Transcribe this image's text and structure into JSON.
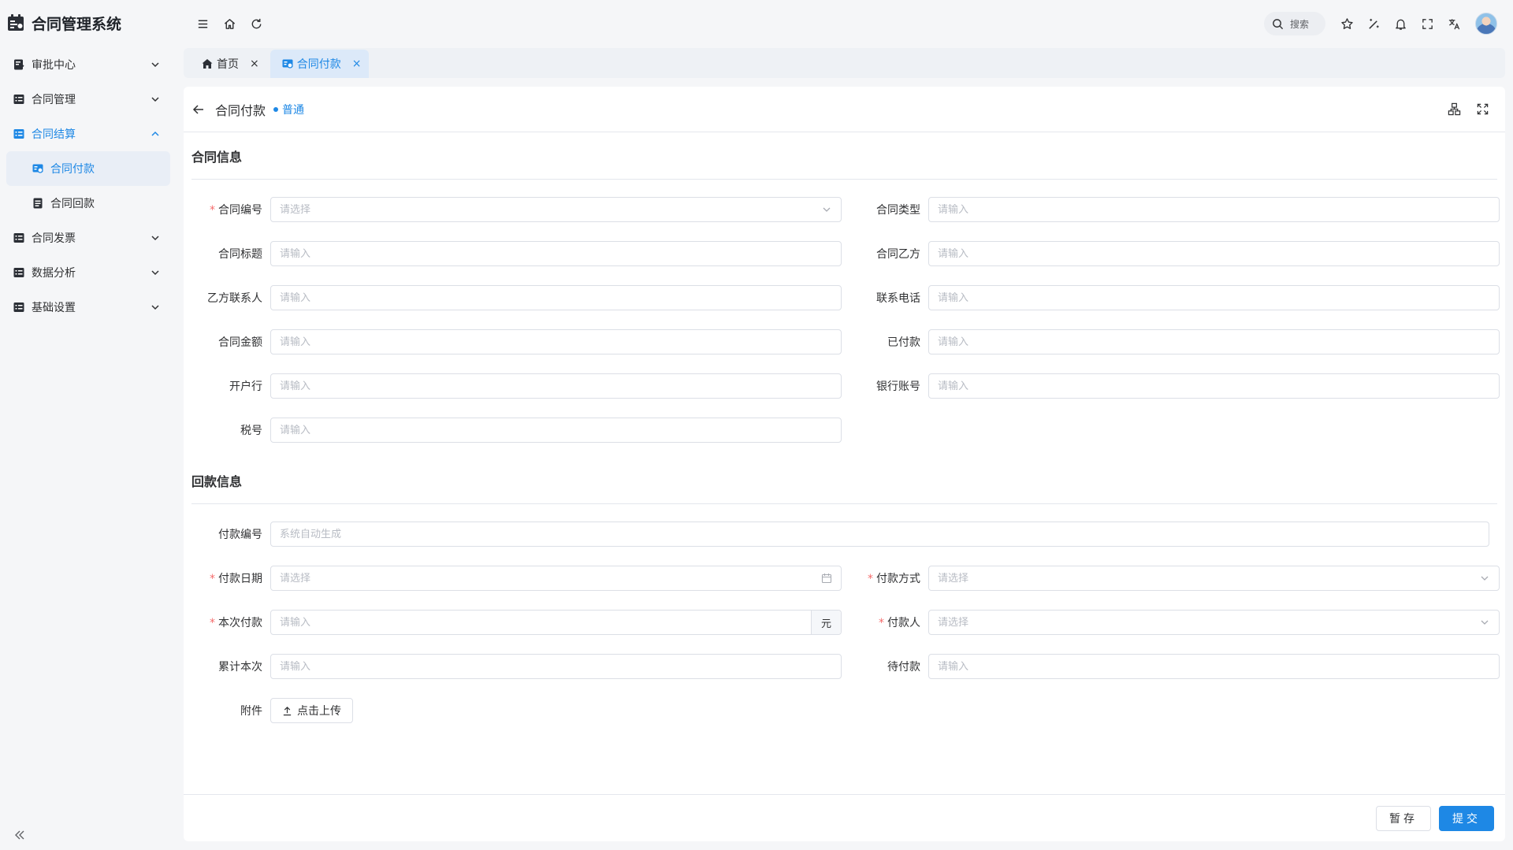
{
  "app": {
    "title": "合同管理系统"
  },
  "sidebar": {
    "items": [
      {
        "label": "审批中心",
        "icon": "approval-icon",
        "expanded": false
      },
      {
        "label": "合同管理",
        "icon": "contract-icon",
        "expanded": false
      },
      {
        "label": "合同结算",
        "icon": "settlement-icon",
        "expanded": true,
        "children": [
          {
            "label": "合同付款",
            "icon": "payment-icon",
            "active": true
          },
          {
            "label": "合同回款",
            "icon": "receipt-icon",
            "active": false
          }
        ]
      },
      {
        "label": "合同发票",
        "icon": "invoice-icon",
        "expanded": false
      },
      {
        "label": "数据分析",
        "icon": "analytics-icon",
        "expanded": false
      },
      {
        "label": "基础设置",
        "icon": "settings-icon",
        "expanded": false
      }
    ]
  },
  "header": {
    "search_label": "搜索",
    "icons": [
      "menu-icon",
      "home-icon",
      "refresh-icon",
      "search-icon",
      "star-icon",
      "magic-icon",
      "bell-icon",
      "fullscreen-icon",
      "translate-icon"
    ]
  },
  "tabs": [
    {
      "label": "首页",
      "icon": "home-icon",
      "active": false
    },
    {
      "label": "合同付款",
      "icon": "payment-icon",
      "active": true
    }
  ],
  "page": {
    "title": "合同付款",
    "badge": "普通"
  },
  "sections": {
    "contract": {
      "title": "合同信息",
      "fields": {
        "contract_no": {
          "label": "合同编号",
          "placeholder": "请选择"
        },
        "contract_type": {
          "label": "合同类型",
          "placeholder": "请输入"
        },
        "contract_title": {
          "label": "合同标题",
          "placeholder": "请输入"
        },
        "party_b": {
          "label": "合同乙方",
          "placeholder": "请输入"
        },
        "party_b_contact": {
          "label": "乙方联系人",
          "placeholder": "请输入"
        },
        "phone": {
          "label": "联系电话",
          "placeholder": "请输入"
        },
        "amount": {
          "label": "合同金额",
          "placeholder": "请输入"
        },
        "paid": {
          "label": "已付款",
          "placeholder": "请输入"
        },
        "bank": {
          "label": "开户行",
          "placeholder": "请输入"
        },
        "bank_account": {
          "label": "银行账号",
          "placeholder": "请输入"
        },
        "tax_no": {
          "label": "税号",
          "placeholder": "请输入"
        }
      }
    },
    "payment": {
      "title": "回款信息",
      "fields": {
        "payment_no": {
          "label": "付款编号",
          "placeholder": "系统自动生成"
        },
        "payment_date": {
          "label": "付款日期",
          "placeholder": "请选择"
        },
        "payment_method": {
          "label": "付款方式",
          "placeholder": "请选择"
        },
        "current_payment": {
          "label": "本次付款",
          "placeholder": "请输入",
          "unit": "元"
        },
        "payer": {
          "label": "付款人",
          "placeholder": "请选择"
        },
        "cumulative": {
          "label": "累计本次",
          "placeholder": "请输入"
        },
        "pending": {
          "label": "待付款",
          "placeholder": "请输入"
        },
        "attachment": {
          "label": "附件",
          "button": "点击上传"
        }
      }
    }
  },
  "footer": {
    "save_label": "暂存",
    "submit_label": "提交"
  },
  "colors": {
    "primary": "#1e88e5",
    "required": "#f56c6c"
  }
}
